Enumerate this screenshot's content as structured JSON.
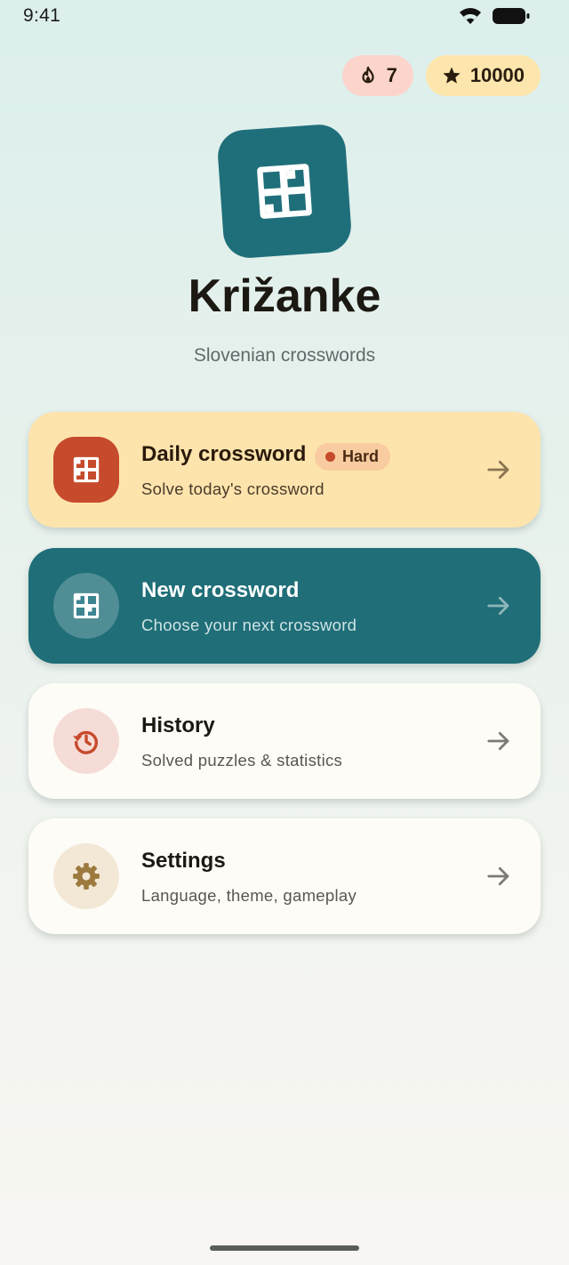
{
  "status_bar": {
    "time": "9:41"
  },
  "stats": {
    "streak": "7",
    "stars": "10000"
  },
  "app": {
    "title": "Križanke",
    "subtitle": "Slovenian crosswords"
  },
  "menu": {
    "daily": {
      "title": "Daily crossword",
      "subtitle": "Solve today's crossword",
      "badge": "Hard"
    },
    "new": {
      "title": "New crossword",
      "subtitle": "Choose your next crossword"
    },
    "history": {
      "title": "History",
      "subtitle": "Solved puzzles & statistics"
    },
    "settings": {
      "title": "Settings",
      "subtitle": "Language, theme, gameplay"
    }
  },
  "icons": {
    "streak": "flame-icon",
    "stars": "star-icon",
    "logo": "crossword-grid-icon",
    "daily": "crossword-grid-icon",
    "new": "crossword-grid-icon",
    "history": "history-icon",
    "settings": "gear-icon",
    "arrow": "arrow-right-icon"
  },
  "colors": {
    "primary": "#1f6e78",
    "accent": "#c64a2c",
    "daily_bg": "#fde4ad",
    "streak_chip": "#fbd5cc",
    "stars_chip": "#fde6ad"
  }
}
